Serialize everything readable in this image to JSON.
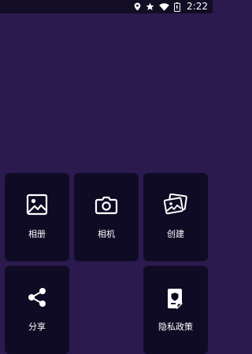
{
  "status_bar": {
    "time": "2:22",
    "icons": [
      "location-icon",
      "star-icon",
      "wifi-icon",
      "battery-icon"
    ]
  },
  "tiles": [
    {
      "label": "相册",
      "icon": "image-icon"
    },
    {
      "label": "相机",
      "icon": "camera-icon"
    },
    {
      "label": "创建",
      "icon": "images-stack-icon"
    },
    {
      "label": "分享",
      "icon": "share-icon"
    },
    {
      "label": "隐私政策",
      "icon": "privacy-policy-icon"
    }
  ],
  "colors": {
    "background": "#2a1a4d",
    "tile": "#0f0b24",
    "status_bar": "#120d25",
    "foreground": "#ffffff"
  }
}
